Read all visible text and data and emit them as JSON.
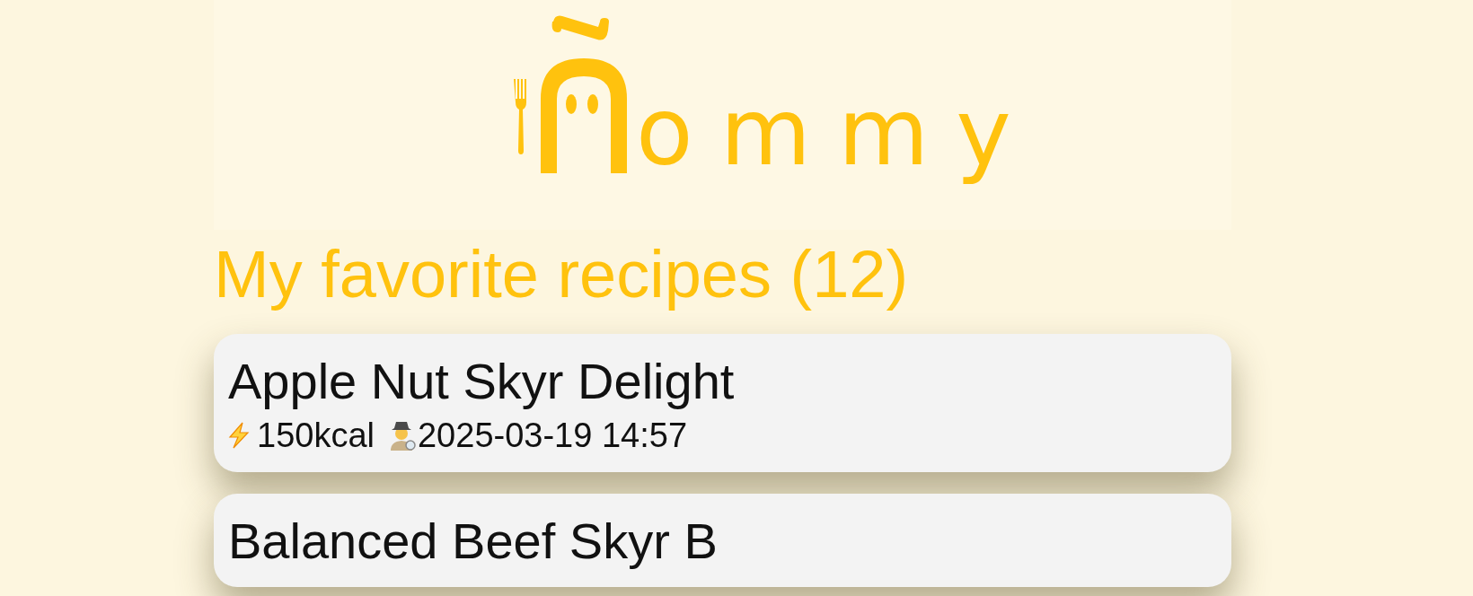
{
  "logo": {
    "text": "ommy"
  },
  "heading": "My favorite recipes (12)",
  "recipes": [
    {
      "title": "Apple Nut Skyr Delight",
      "calories": "150kcal",
      "date": "2025-03-19 14:57"
    },
    {
      "title": "Balanced Beef Skyr B"
    }
  ]
}
